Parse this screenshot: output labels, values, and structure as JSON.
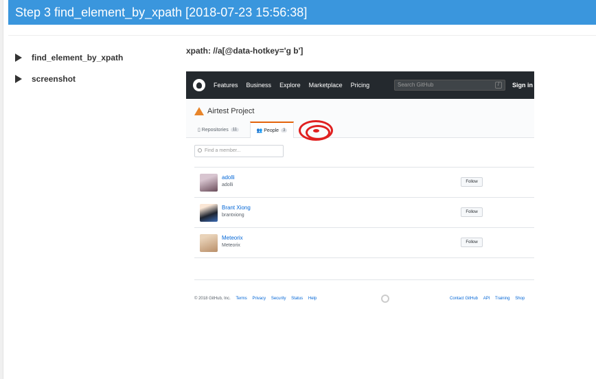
{
  "header": {
    "title": "Step 3 find_element_by_xpath [2018-07-23 15:56:38]"
  },
  "tree": {
    "items": [
      "find_element_by_xpath",
      "screenshot"
    ]
  },
  "detail": {
    "xpath": "xpath: //a[@data-hotkey='g b']"
  },
  "screenshot": {
    "nav": {
      "items": [
        "Features",
        "Business",
        "Explore",
        "Marketplace",
        "Pricing"
      ],
      "search_placeholder": "Search GitHub",
      "slash": "/",
      "sign_in": "Sign in"
    },
    "org": {
      "name": "Airtest Project",
      "tabs": [
        {
          "label": "Repositories",
          "count": "11"
        },
        {
          "label": "People",
          "count": "3"
        }
      ]
    },
    "find_placeholder": "Find a member...",
    "members": [
      {
        "name": "adolli",
        "login": "adolli",
        "follow": "Follow"
      },
      {
        "name": "Brant Xiong",
        "login": "brantxiong",
        "follow": "Follow"
      },
      {
        "name": "Meteorix",
        "login": "Meteorix",
        "follow": "Follow"
      }
    ],
    "footer": {
      "copyright": "© 2018 GitHub, Inc.",
      "left_links": [
        "Terms",
        "Privacy",
        "Security",
        "Status",
        "Help"
      ],
      "right_links": [
        "Contact GitHub",
        "API",
        "Training",
        "Shop"
      ]
    }
  },
  "colors": {
    "header_bg": "#3a96dd",
    "target": "#e02020",
    "github_nav": "#24292e"
  }
}
